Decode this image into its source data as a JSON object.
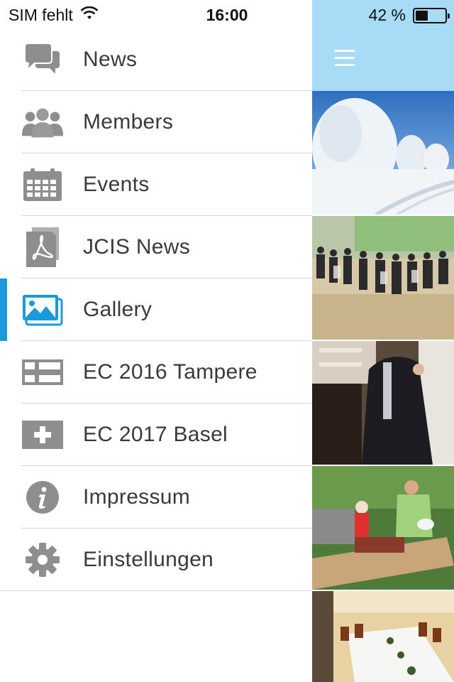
{
  "status_bar": {
    "carrier": "SIM fehlt",
    "time": "16:00",
    "battery_text": "42 %",
    "battery_level": 0.42
  },
  "menu": {
    "items": [
      {
        "label": "News",
        "icon": "speech-bubbles-icon"
      },
      {
        "label": "Members",
        "icon": "people-group-icon"
      },
      {
        "label": "Events",
        "icon": "calendar-icon"
      },
      {
        "label": "JCIS News",
        "icon": "pdf-document-icon"
      },
      {
        "label": "Gallery",
        "icon": "picture-gallery-icon",
        "active": true
      },
      {
        "label": "EC 2016 Tampere",
        "icon": "finland-flag-icon"
      },
      {
        "label": "EC 2017 Basel",
        "icon": "swiss-flag-icon"
      },
      {
        "label": "Impressum",
        "icon": "info-icon"
      },
      {
        "label": "Einstellungen",
        "icon": "gear-icon"
      }
    ]
  },
  "colors": {
    "accent": "#1a9ad9",
    "header_bg": "#a8dcf6",
    "icon_gray": "#8e8e8e"
  },
  "gallery": {
    "tiles": [
      "snowy-landscape-photo",
      "seated-audience-photo",
      "speaker-in-suit-photo",
      "outdoor-baking-photo",
      "banquet-table-photo"
    ]
  }
}
